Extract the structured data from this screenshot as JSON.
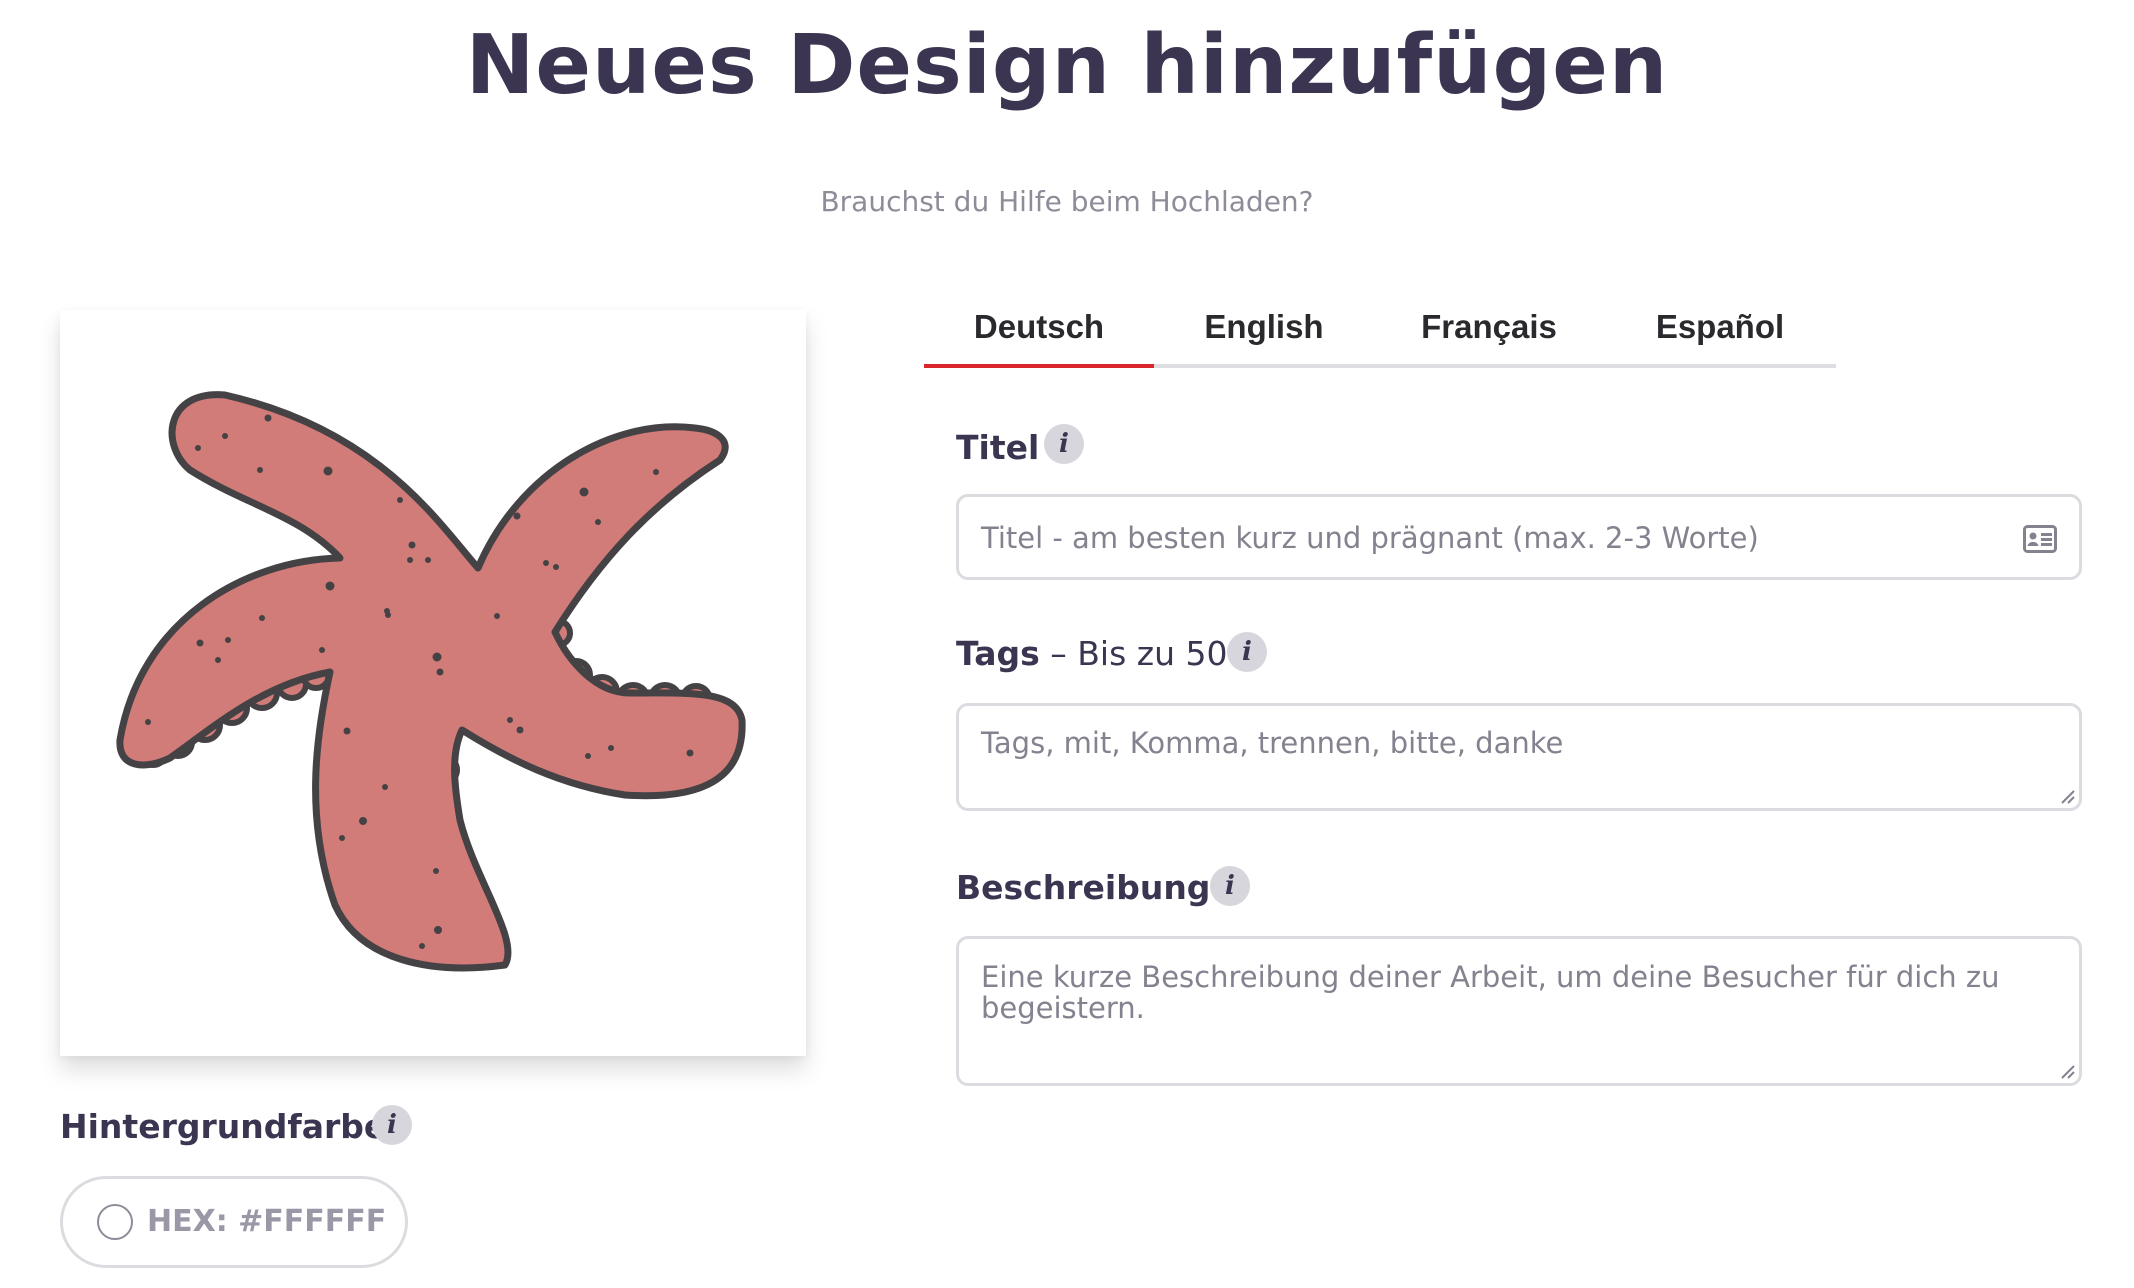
{
  "page": {
    "title": "Neues Design hinzufügen",
    "help_link": "Brauchst du Hilfe beim Hochladen?"
  },
  "preview": {
    "image_icon": "starfish-illustration",
    "fill_color": "#d27c79",
    "outline_color": "#454245"
  },
  "background_color": {
    "label": "Hintergrundfarbe",
    "info_icon": "info-icon",
    "hex_value": "HEX: #FFFFFF",
    "swatch_color": "#FFFFFF"
  },
  "language_tabs": {
    "active_index": 0,
    "active_color": "#d9262a",
    "items": [
      {
        "label": "Deutsch"
      },
      {
        "label": "English"
      },
      {
        "label": "Français"
      },
      {
        "label": "Español"
      }
    ]
  },
  "form": {
    "title": {
      "label": "Titel",
      "placeholder": "Titel - am besten kurz und prägnant (max. 2-3 Worte)",
      "icon": "contact-card-icon"
    },
    "tags": {
      "label": "Tags",
      "label_suffix": " – Bis zu 50",
      "placeholder": "Tags, mit, Komma, trennen, bitte, danke"
    },
    "description": {
      "label": "Beschreibung",
      "placeholder": "Eine kurze Beschreibung deiner Arbeit, um deine Besucher für dich zu begeistern."
    }
  }
}
